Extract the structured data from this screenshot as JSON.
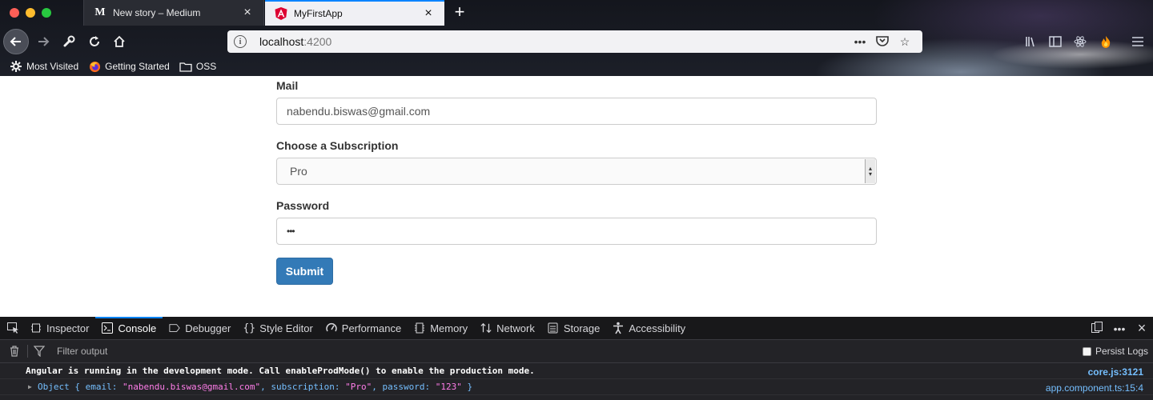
{
  "browser": {
    "tabs": [
      {
        "title": "New story – Medium",
        "favicon": "medium-m-icon",
        "active": false
      },
      {
        "title": "MyFirstApp",
        "favicon": "angular-icon",
        "active": true
      }
    ],
    "url": {
      "host": "localhost",
      "port": ":4200"
    },
    "bookmarks": [
      {
        "label": "Most Visited",
        "icon": "gear-icon"
      },
      {
        "label": "Getting Started",
        "icon": "firefox-icon"
      },
      {
        "label": "OSS",
        "icon": "folder-icon"
      }
    ]
  },
  "form": {
    "mail_label": "Mail",
    "mail_value": "nabendu.biswas@gmail.com",
    "subscription_label": "Choose a Subscription",
    "subscription_value": "Pro",
    "password_label": "Password",
    "password_value": "•••",
    "submit_label": "Submit",
    "submit_color": "#337ab7"
  },
  "devtools": {
    "tabs": [
      {
        "label": "Inspector",
        "icon": "inspector-icon"
      },
      {
        "label": "Console",
        "icon": "console-icon",
        "selected": true
      },
      {
        "label": "Debugger",
        "icon": "debugger-icon"
      },
      {
        "label": "Style Editor",
        "icon": "braces-icon"
      },
      {
        "label": "Performance",
        "icon": "gauge-icon"
      },
      {
        "label": "Memory",
        "icon": "memory-icon"
      },
      {
        "label": "Network",
        "icon": "arrows-icon"
      },
      {
        "label": "Storage",
        "icon": "storage-icon"
      },
      {
        "label": "Accessibility",
        "icon": "accessibility-icon"
      }
    ],
    "filter_placeholder": "Filter output",
    "persist_logs_label": "Persist Logs",
    "messages": {
      "m1_text": "Angular is running in the development mode. Call enableProdMode() to enable the production mode.",
      "m1_source": "core.js:3121",
      "m2_source": "app.component.ts:15:4",
      "m2": {
        "prefix": "Object { ",
        "k1": "email: ",
        "v1": "\"nabendu.biswas@gmail.com\"",
        "k2": ", subscription: ",
        "v2": "\"Pro\"",
        "k3": ", password: ",
        "v3": "\"123\"",
        "suffix": " }"
      }
    }
  }
}
